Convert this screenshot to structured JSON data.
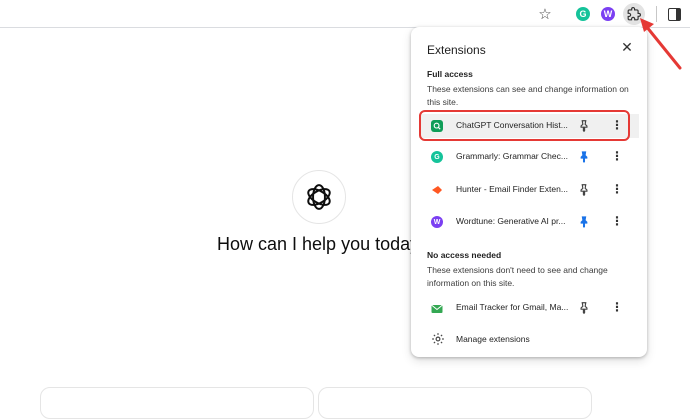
{
  "page": {
    "headline": "How can I help you today"
  },
  "toolbar": {
    "grammarly_badge": "G",
    "wordtune_badge": "W"
  },
  "extensions_popup": {
    "title": "Extensions",
    "full_access": {
      "heading": "Full access",
      "description": "These extensions can see and change information on this site.",
      "items": [
        {
          "name": "ChatGPT Conversation Hist...",
          "icon": "chatgpt-history-icon",
          "icon_color": "#0f9d58",
          "pinned": false
        },
        {
          "name": "Grammarly: Grammar Chec...",
          "icon": "grammarly-icon",
          "icon_color": "#15c39a",
          "pinned": true
        },
        {
          "name": "Hunter - Email Finder Exten...",
          "icon": "hunter-icon",
          "icon_color": "#ff5722",
          "pinned": false
        },
        {
          "name": "Wordtune: Generative AI pr...",
          "icon": "wordtune-icon",
          "icon_color": "#7b3ff2",
          "pinned": true
        }
      ]
    },
    "no_access": {
      "heading": "No access needed",
      "description": "These extensions don't need to see and change information on this site.",
      "items": [
        {
          "name": "Email Tracker for Gmail, Ma...",
          "icon": "email-tracker-icon",
          "icon_color": "#34a853",
          "pinned": false
        }
      ]
    },
    "manage_label": "Manage extensions"
  },
  "colors": {
    "accent_pin": "#1a73e8",
    "annotation_red": "#e53935"
  }
}
